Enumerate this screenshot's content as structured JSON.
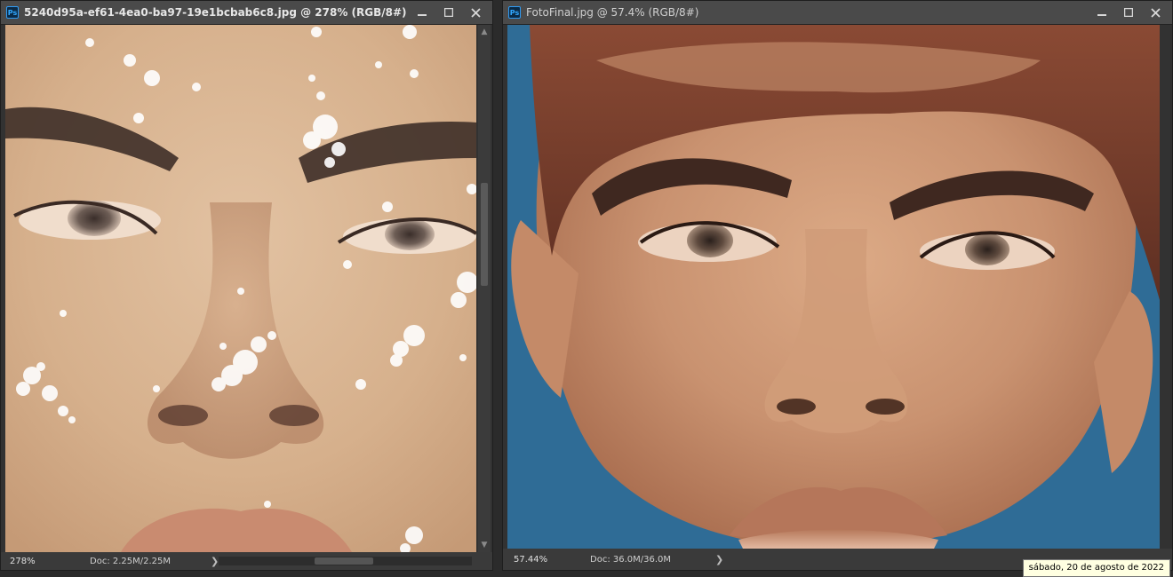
{
  "left_window": {
    "title": "5240d95a-ef61-4ea0-ba97-19e1bcbab6c8.jpg @ 278% (RGB/8#)",
    "app_icon_label": "Ps",
    "zoom": "278%",
    "doc_info": "Doc: 2.25M/2.25M",
    "image_description": "Extreme close-up of a face with white speckle artifacts",
    "minimize_icon": "minimize-icon",
    "maximize_icon": "maximize-icon",
    "close_icon": "close-icon"
  },
  "right_window": {
    "title": "FotoFinal.jpg @ 57.4% (RGB/8#)",
    "app_icon_label": "Ps",
    "zoom": "57.44%",
    "doc_info": "Doc: 36.0M/36.0M",
    "image_description": "Restored close-up portrait on blue background",
    "minimize_icon": "minimize-icon",
    "maximize_icon": "maximize-icon",
    "close_icon": "close-icon"
  },
  "status_arrow": "❯",
  "tooltip": {
    "text": "sábado, 20 de agosto de 2022"
  },
  "colors": {
    "workspace": "#2b2b2b",
    "titlebar": "#4a4a4a",
    "skin_left": "#d8b38f",
    "skin_right": "#c78f6c",
    "background_blue": "#2f6c96"
  }
}
